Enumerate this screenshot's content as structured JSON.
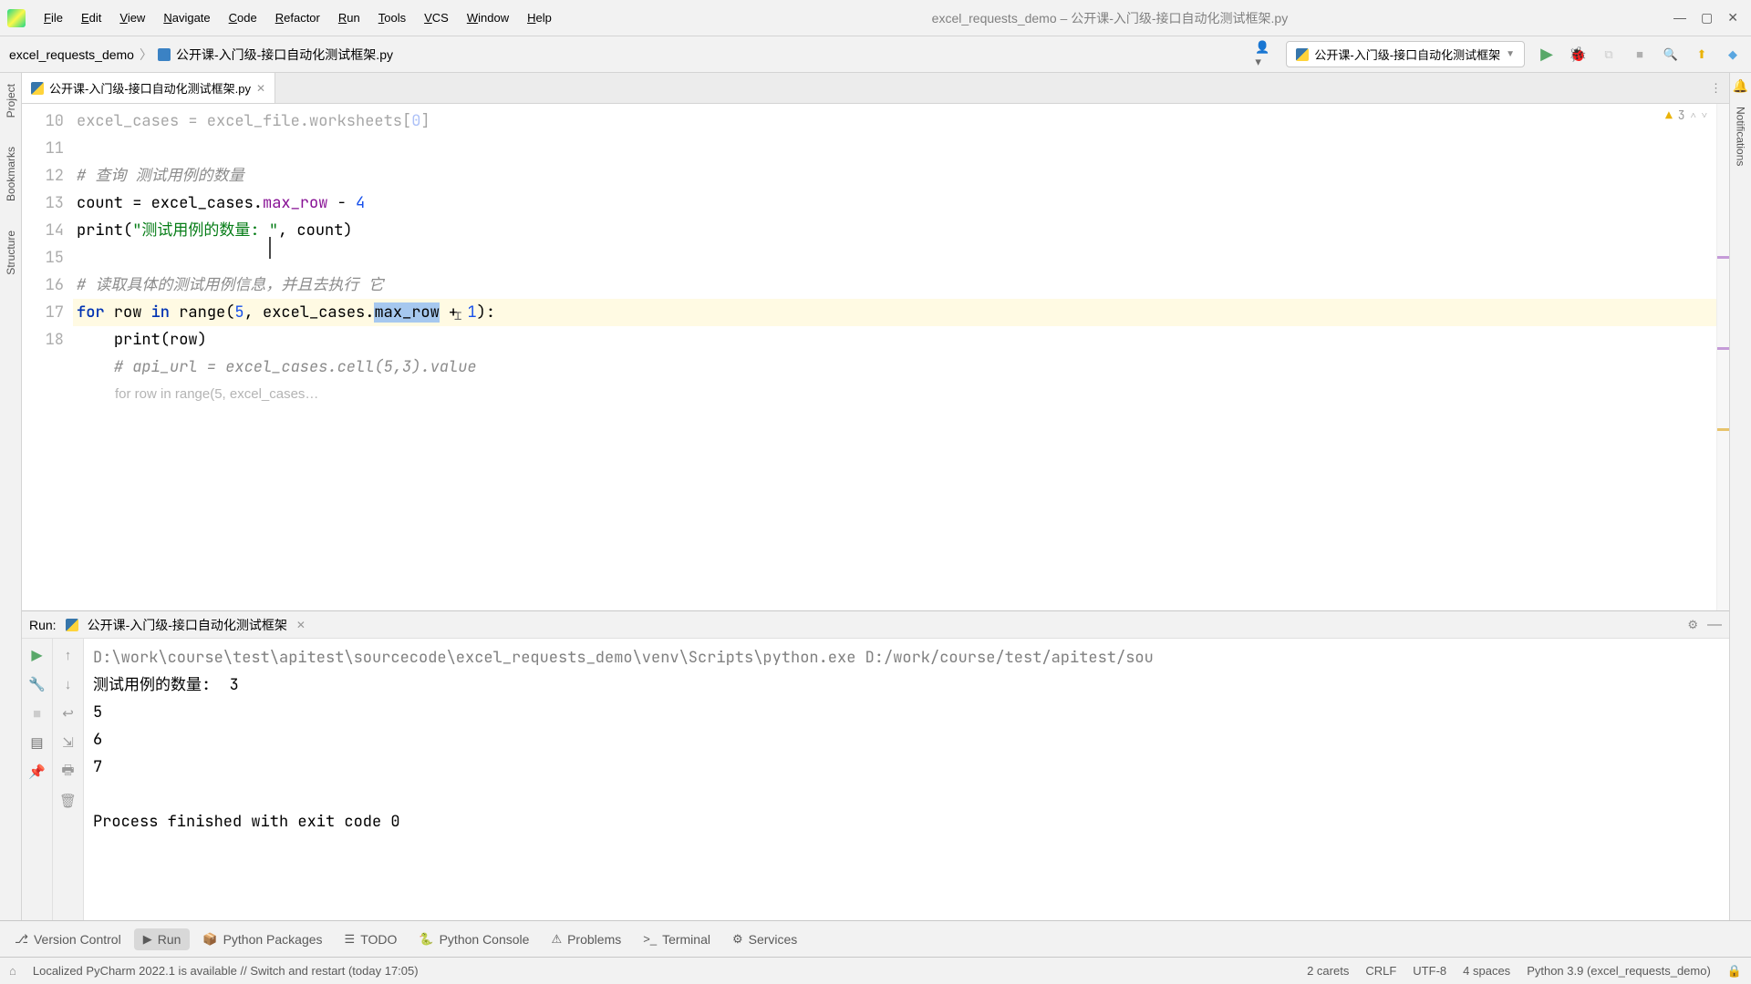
{
  "menus": [
    "File",
    "Edit",
    "View",
    "Navigate",
    "Code",
    "Refactor",
    "Run",
    "Tools",
    "VCS",
    "Window",
    "Help"
  ],
  "window_title": "excel_requests_demo – 公开课-入门级-接口自动化测试框架.py",
  "breadcrumb": {
    "root": "excel_requests_demo",
    "file": "公开课-入门级-接口自动化测试框架.py"
  },
  "run_config": {
    "name": "公开课-入门级-接口自动化测试框架"
  },
  "editor": {
    "tab_name": "公开课-入门级-接口自动化测试框架.py",
    "warning_count": "3",
    "gutter": [
      "",
      "10",
      "11",
      "12",
      "13",
      "14",
      "15",
      "16",
      "17",
      "18"
    ],
    "fold_hint": "for row in range(5, excel_cases…",
    "raw_lines": {
      "l9": "excel_cases = excel_file.worksheets[0]",
      "l10": "",
      "l11": "# 查询 测试用例的数量",
      "l12": "count = excel_cases.max_row - 4",
      "l13": "print(\"测试用例的数量: \", count)",
      "l14": "",
      "l15": "# 读取具体的测试用例信息，并且去执行 它",
      "l16": "for row in range(5, excel_cases.max_row + 1):",
      "l17": "    print(row)",
      "l18": "    # api_url = excel_cases.cell(5,3).value"
    }
  },
  "run": {
    "label": "Run:",
    "tab": "公开课-入门级-接口自动化测试框架",
    "output": [
      "D:\\work\\course\\test\\apitest\\sourcecode\\excel_requests_demo\\venv\\Scripts\\python.exe D:/work/course/test/apitest/sou",
      "测试用例的数量:  3",
      "5",
      "6",
      "7",
      "",
      "Process finished with exit code 0"
    ]
  },
  "bottom_tools": [
    {
      "icon": "⎇",
      "label": "Version Control"
    },
    {
      "icon": "▶",
      "label": "Run"
    },
    {
      "icon": "📦",
      "label": "Python Packages"
    },
    {
      "icon": "☰",
      "label": "TODO"
    },
    {
      "icon": "🐍",
      "label": "Python Console"
    },
    {
      "icon": "⚠",
      "label": "Problems"
    },
    {
      "icon": ">_",
      "label": "Terminal"
    },
    {
      "icon": "⚙",
      "label": "Services"
    }
  ],
  "status": {
    "msg": "Localized PyCharm 2022.1 is available // Switch and restart (today 17:05)",
    "carets": "2 carets",
    "eol": "CRLF",
    "enc": "UTF-8",
    "indent": "4 spaces",
    "sdk": "Python 3.9 (excel_requests_demo)"
  },
  "left_tabs": [
    "Project",
    "Bookmarks",
    "Structure"
  ],
  "right_tabs": [
    "Notifications"
  ]
}
